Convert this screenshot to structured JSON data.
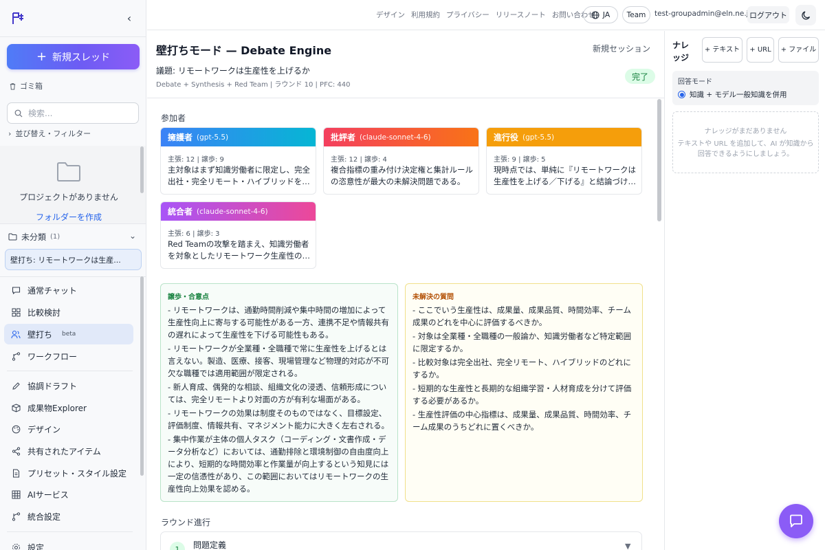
{
  "sidebar": {
    "new_thread_label": "新規スレッド",
    "trash_label": "ゴミ箱",
    "search_placeholder": "検索...",
    "sort_filter_label": "並び替え・フィルター",
    "no_projects": "プロジェクトがありません",
    "create_folder": "フォルダーを作成",
    "uncategorized": {
      "label": "未分類",
      "count": "(1)"
    },
    "thread_item": "壁打ち: リモートワークは生産...",
    "nav": [
      {
        "label": "通常チャット",
        "icon": "chat-bubble-icon"
      },
      {
        "label": "比較検討",
        "icon": "grid-icon"
      },
      {
        "label": "壁打ち",
        "icon": "users-icon",
        "badge": "beta",
        "active": true
      },
      {
        "label": "ワークフロー",
        "icon": "workflow-icon"
      },
      {
        "label": "協調ドラフト",
        "icon": "pencil-icon"
      },
      {
        "label": "成果物Explorer",
        "icon": "package-icon"
      },
      {
        "label": "デザイン",
        "icon": "palette-icon"
      },
      {
        "label": "共有されたアイテム",
        "icon": "share-icon"
      },
      {
        "label": "プリセット・スタイル設定",
        "icon": "document-icon"
      },
      {
        "label": "AIサービス",
        "icon": "table-icon"
      },
      {
        "label": "統合設定",
        "icon": "branch-icon"
      },
      {
        "label": "設定",
        "icon": "gear-icon"
      }
    ]
  },
  "topbar": {
    "links": [
      "デザイン",
      "利用規約",
      "プライバシー",
      "リリースノート",
      "お問い合わせ"
    ],
    "lang": "JA",
    "team": "Team",
    "user_email": "test-groupadmin@eln.ne.jp",
    "logout": "ログアウト"
  },
  "main": {
    "title": "壁打ちモード — Debate Engine",
    "new_session": "新規セッション",
    "topic": "議題: リモートワークは生産性を上げるか",
    "meta": "Debate + Synthesis + Red Team | ラウンド 10 | PFC: 440",
    "status": "完了",
    "participants_label": "参加者",
    "participants": [
      {
        "role": "擁護者",
        "model": "(gpt-5.5)",
        "stats": "主張: 12 | 譲歩: 9",
        "summary": "主対象はまず知識労働者に限定し、完全出社・完全リモート・ハイブリッドを比較する。",
        "gradient": [
          "#3b82f6",
          "#06b6d4"
        ]
      },
      {
        "role": "批評者",
        "model": "(claude-sonnet-4-6)",
        "stats": "主張: 12 | 譲歩: 4",
        "summary": "複合指標の重み付け決定権と集計ルールの恣意性が最大の未解決問題である。",
        "gradient": [
          "#f43f5e",
          "#f97316"
        ]
      },
      {
        "role": "進行役",
        "model": "(gpt-5.5)",
        "stats": "主張: 9 | 譲歩: 5",
        "summary": "現時点では、単純に『リモートワークは生産性を上げる／下げる』と結論づけることはできない。",
        "gradient": [
          "#f59e0b",
          "#f59e0b"
        ]
      },
      {
        "role": "統合者",
        "model": "(claude-sonnet-4-6)",
        "stats": "主張: 6 | 譲歩: 3",
        "summary": "Red Teamの攻撃を踏まえ、知識労働者を対象としたリモートワーク生産性の評価を再構成する。",
        "gradient": [
          "#a855f7",
          "#ec4899"
        ]
      }
    ],
    "concessions": {
      "title": "譲歩・合意点",
      "items": [
        "- リモートワークは、通勤時間削減や集中時間の増加によって生産性向上に寄与する可能性がある一方、連携不足や情報共有の遅れによって生産性を下げる可能性もある。",
        "- リモートワークが全業種・全職種で常に生産性を上げるとは言えない。製造、医療、接客、現場管理など物理的対応が不可欠な職種では適用範囲が限定される。",
        "- 新人育成、偶発的な相談、組織文化の浸透、信頼形成については、完全リモートより対面の方が有利な場面がある。",
        "- リモートワークの効果は制度そのものではなく、目標設定、評価制度、情報共有、マネジメント能力に大きく左右される。",
        "- 集中作業が主体の個人タスク（コーディング・文書作成・データ分析など）においては、通勤排除と環境制御の自由度向上により、短期的な時間効率と作業量が向上するという知見には一定の信憑性があり、この範囲においてはリモートワークの生産性向上効果を認める。"
      ]
    },
    "open_questions": {
      "title": "未解決の質問",
      "items": [
        "- ここでいう生産性は、成果量、成果品質、時間効率、チーム成果のどれを中心に評価するべきか。",
        "- 対象は全業種・全職種の一般論か、知識労働者など特定範囲に限定するか。",
        "- 比較対象は完全出社、完全リモート、ハイブリッドのどれにするか。",
        "- 短期的な生産性と長期的な組織学習・人材育成を分けて評価する必要があるか。",
        "- 生産性評価の中心指標は、成果量、成果品質、時間効率、チーム成果のうちどれに置くべきか。"
      ]
    },
    "rounds_label": "ラウンド進行",
    "rounds": [
      {
        "num": "1",
        "title": "問題定義"
      }
    ]
  },
  "knowledge": {
    "title": "ナレッジ",
    "buttons": [
      "+ テキスト",
      "+ URL",
      "+ ファイル"
    ],
    "response_mode_label": "回答モード",
    "response_mode_option": "知識 + モデル一般知識を併用",
    "empty_title": "ナレッジがまだありません",
    "empty_desc": "テキストや URL を追加して、AI が知識から回答できるようにしましょう。"
  },
  "colors": {
    "accent": "#2563eb",
    "fab": "#8b5cf6",
    "success": "#15803d"
  }
}
